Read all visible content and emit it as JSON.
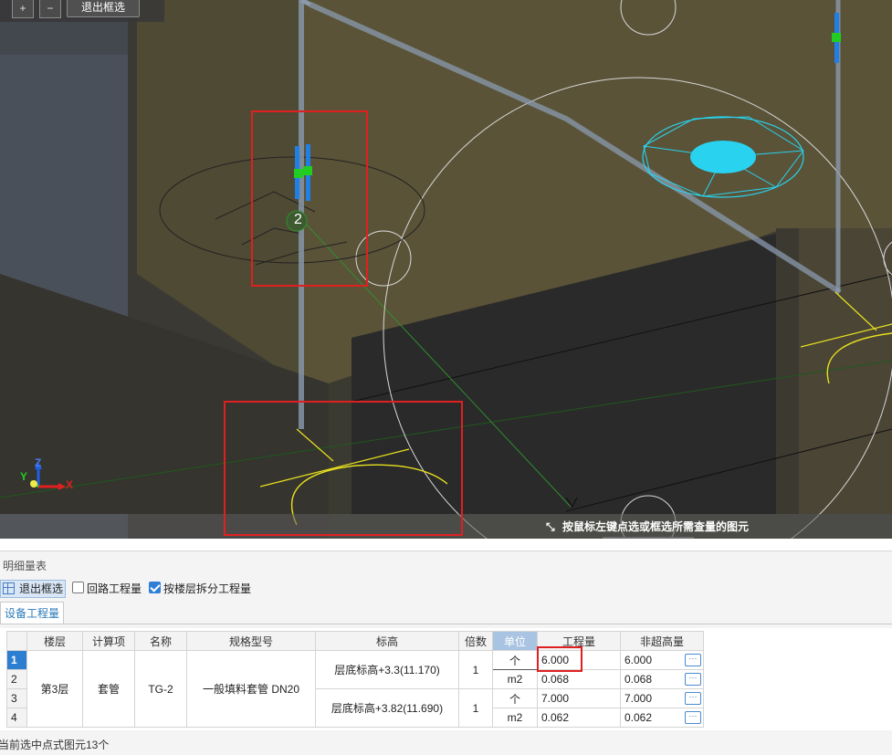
{
  "viewport": {
    "toolbar": {
      "zoom_in_icon": "select-add-icon",
      "zoom_out_icon": "select-remove-icon",
      "exit_select_label": "退出框选"
    },
    "pipe_number_label": "2",
    "hint": "按鼠标左键点选或框选所需查量的图元",
    "axis": {
      "x": "X",
      "y": "Y",
      "z": "Z"
    },
    "colors": {
      "pipe_blue": "#1f7fe6",
      "marker_green": "#22cc22",
      "cyan": "#29d3f0",
      "yellow": "#e8e020",
      "red_box": "#e02020"
    }
  },
  "panel": {
    "title": "明细量表",
    "exit_select_label": "退出框选",
    "loop_quantity_label": "回路工程量",
    "loop_quantity_checked": false,
    "split_by_floor_label": "按楼层拆分工程量",
    "split_by_floor_checked": true,
    "tab_label": "设备工程量",
    "table": {
      "headers": [
        "楼层",
        "计算项",
        "名称",
        "规格型号",
        "标高",
        "倍数",
        "单位",
        "工程量",
        "非超高量"
      ],
      "row_numbers": [
        "1",
        "2",
        "3",
        "4"
      ],
      "floor": "第3层",
      "item": "套管",
      "name": "TG-2",
      "spec": "一般填料套管 DN20",
      "elev_a": "层底标高+3.3(11.170)",
      "elev_b": "层底标高+3.82(11.690)",
      "mult_a": "1",
      "mult_b": "1",
      "units": [
        "个",
        "m2",
        "个",
        "m2"
      ],
      "quantities": [
        "6.000",
        "0.068",
        "7.000",
        "0.062"
      ],
      "non_over": [
        "6.000",
        "0.068",
        "7.000",
        "0.062"
      ],
      "more_label": "···"
    },
    "status": "当前选中点式图元13个"
  }
}
